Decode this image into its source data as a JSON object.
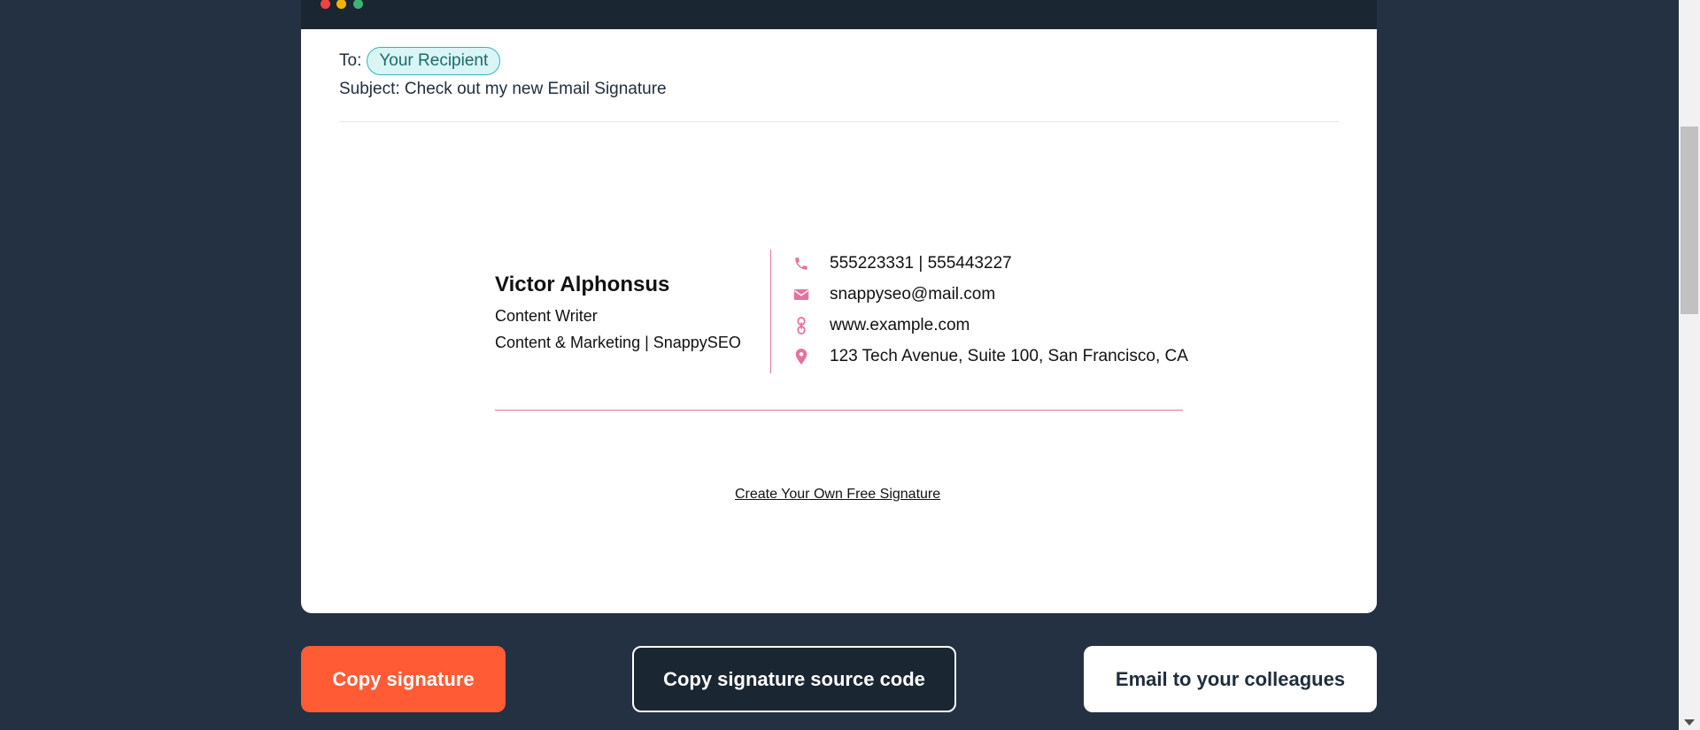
{
  "email": {
    "to_label": "To:",
    "recipient": "Your Recipient",
    "subject": "Subject: Check out my new Email Signature"
  },
  "signature": {
    "name": "Victor Alphonsus",
    "title": "Content Writer",
    "company": "Content & Marketing | SnappySEO",
    "phone": "555223331 | 555443227",
    "email": "snappyseo@mail.com",
    "website": "www.example.com",
    "address": "123 Tech Avenue, Suite 100, San Francisco, CA",
    "accent_color": "#e5739f",
    "footer_link": "Create Your Own Free Signature"
  },
  "buttons": {
    "copy_signature": "Copy signature",
    "copy_source": "Copy signature source code",
    "email_colleagues": "Email to your colleagues"
  },
  "icons": [
    "phone-icon",
    "mail-icon",
    "link-icon",
    "location-pin-icon"
  ]
}
